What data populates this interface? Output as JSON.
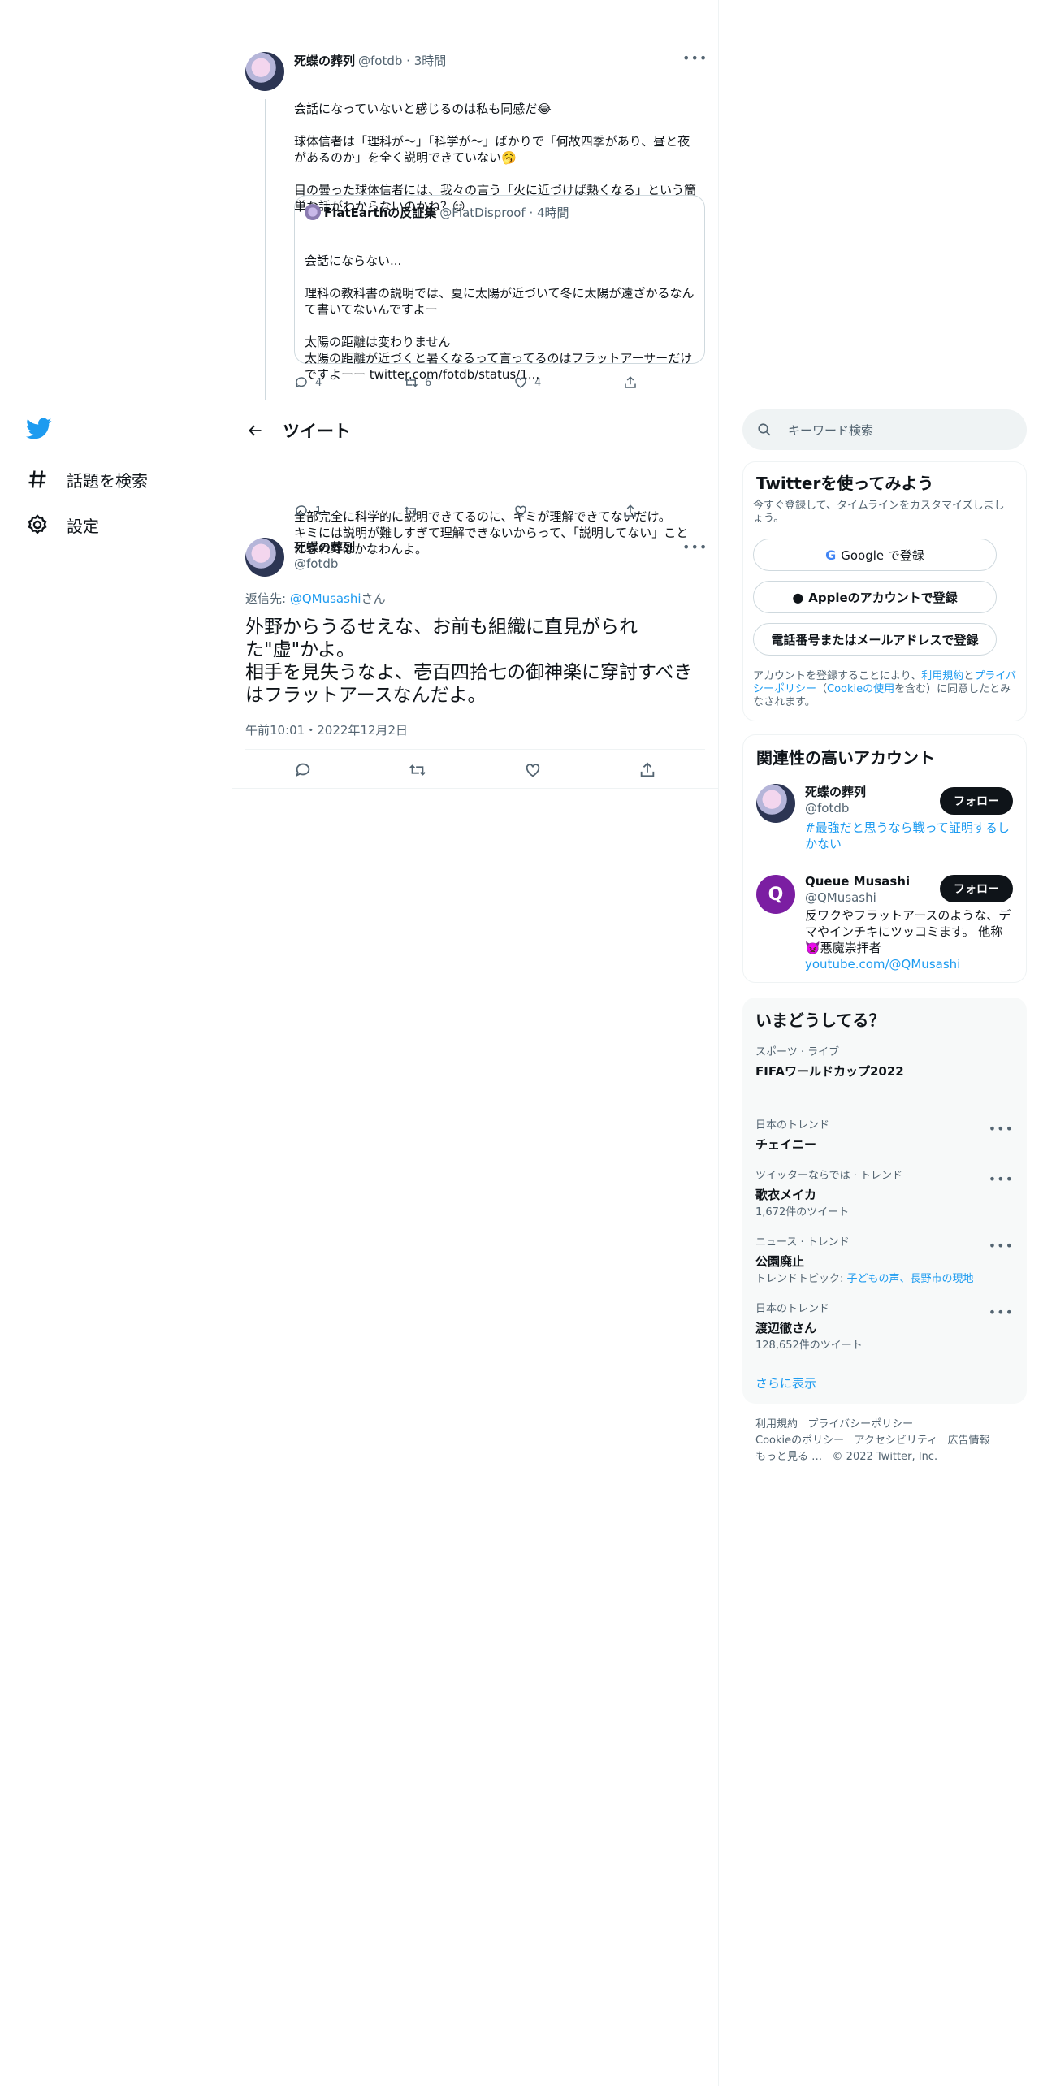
{
  "nav": {
    "explore_label": "話題を検索",
    "settings_label": "設定"
  },
  "header": {
    "title": "ツイート"
  },
  "tweet1": {
    "name": "死蝶の葬列",
    "handle_time": "@fotdb · 3時間",
    "lines": [
      "会話になっていないと感じるのは私も同感だ😂",
      "",
      "球体信者は「理科が〜」「科学が〜」ばかりで「何故四季があり、昼と夜",
      "があるのか」を全く説明できていない🥱",
      "",
      "目の曇った球体信者には、我々の言う「火に近づけば熱くなる」という簡",
      "単な話がわからないのかね？😏"
    ],
    "quote": {
      "name": "FlatEarthの反証集",
      "handle_time": "@FlatDisproof · 4時間",
      "lines": [
        "会話にならない...",
        "",
        "理科の教科書の説明では、夏に太陽が近づいて冬に太陽が遠ざかるなん",
        "て書いてないんですよー",
        "",
        "太陽の距離は変わりません",
        "太陽の距離が近づくと暑くなるって言ってるのはフラットアーサーだけ",
        "ですよーー twitter.com/fotdb/status/1..."
      ]
    },
    "reply_count": "4",
    "retweet_count": "6",
    "like_count": "4"
  },
  "tweet2": {
    "lines": [
      "全部完全に科学的に説明できてるのに、キミが理解できてないだけ。",
      "キミには説明が難しすぎて理解できないからって、「説明してない」こと",
      "にされてはかなわんよ。"
    ],
    "reply_count": "1"
  },
  "main_tweet": {
    "name": "死蝶の葬列",
    "handle": "@fotdb",
    "reply_prefix": "返信先: ",
    "reply_to": "@QMusashi",
    "reply_suffix": "さん",
    "lines": [
      "外野からうるせえな、お前も組織に直見がられ",
      "た\"虚\"かよ。",
      "相手を見失うなよ、壱百四拾七の御神楽に穿討すべき",
      "はフラットアースなんだよ。"
    ],
    "timestamp": "午前10:01・2022年12月2日"
  },
  "search": {
    "placeholder": "キーワード検索"
  },
  "signup": {
    "title": "Twitterを使ってみよう",
    "subtitle": "今すぐ登録して、タイムラインをカスタマイズしましょう。",
    "google": "Google で登録",
    "apple": "Appleのアカウントで登録",
    "phone": "電話番号またはメールアドレスで登録",
    "terms_a": "アカウントを登録することにより、",
    "terms_link1": "利用規約",
    "terms_b": "と",
    "terms_link2": "プライバシーポリシー",
    "terms_c": "（",
    "terms_link3": "Cookieの使用",
    "terms_d": "を含む）に同意したとみなされます。"
  },
  "relevant": {
    "title": "関連性の高いアカウント",
    "follow_label": "フォロー",
    "accounts": [
      {
        "name": "死蝶の葬列",
        "handle": "@fotdb",
        "bio": "#最強だと思うなら戦って証明するしかない"
      },
      {
        "name": "Queue Musashi",
        "handle": "@QMusashi",
        "bio1": "反ワクやフラットアースのような、デ",
        "bio2": "マやインチキにツッコミます。 他称",
        "bio3": "👿悪魔崇拝者",
        "link": "youtube.com/@QMusashi"
      }
    ]
  },
  "trends": {
    "title": "いまどうしてる？",
    "items": [
      {
        "category": "スポーツ · ライブ",
        "name": "FIFAワールドカップ2022",
        "extra": ""
      },
      {
        "category": "日本のトレンド",
        "name": "チェイニー",
        "extra": ""
      },
      {
        "category": "ツイッターならでは · トレンド",
        "name": "歌衣メイカ",
        "extra": "1,672件のツイート"
      },
      {
        "category": "ニュース · トレンド",
        "name": "公園廃止",
        "extra_prefix": "トレンドトピック: ",
        "extra_link": "子どもの声、長野市の現地"
      },
      {
        "category": "日本のトレンド",
        "name": "渡辺徹さん",
        "extra": "128,652件のツイート"
      }
    ],
    "show_more": "さらに表示"
  },
  "footer": {
    "terms": "利用規約",
    "privacy": "プライバシーポリシー",
    "cookie": "Cookieのポリシー",
    "accessibility": "アクセシビリティ",
    "ads": "広告情報",
    "more": "もっと見る …",
    "copyright": "© 2022 Twitter, Inc."
  },
  "colors": {
    "accent": "#1d9bf0",
    "text": "#0f1419",
    "muted": "#536471"
  }
}
